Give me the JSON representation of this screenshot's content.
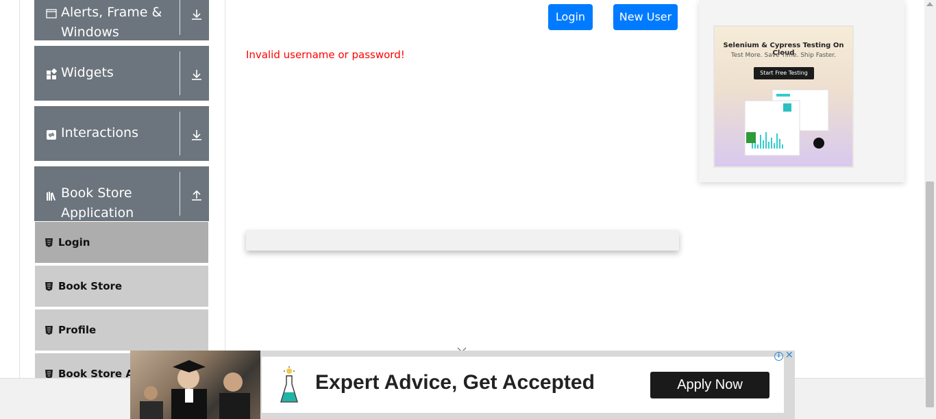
{
  "sidebar": {
    "groups": [
      {
        "label_line1": "Alerts, Frame &",
        "label_line2": "Windows",
        "icon": "window-icon",
        "arrow": "download-arrow-icon"
      },
      {
        "label": "Widgets",
        "icon": "widgets-icon",
        "arrow": "download-arrow-icon"
      },
      {
        "label": "Interactions",
        "icon": "interactions-icon",
        "arrow": "download-arrow-icon"
      },
      {
        "label_line1": "Book Store",
        "label_line2": "Application",
        "icon": "books-icon",
        "arrow": "upload-arrow-icon"
      }
    ],
    "items": [
      {
        "label": "Login",
        "active": true
      },
      {
        "label": "Book Store"
      },
      {
        "label": "Profile"
      },
      {
        "label": "Book Store API"
      }
    ]
  },
  "main": {
    "login_button": "Login",
    "new_user_button": "New User",
    "error_message": "Invalid username or password!"
  },
  "right_ad": {
    "title": "Selenium & Cypress Testing On Cloud",
    "subtitle": "Test More. Save Time. Ship Faster.",
    "cta": "Start Free Testing"
  },
  "bottom_ad": {
    "headline": "Expert Advice, Get Accepted",
    "cta": "Apply Now",
    "info": "i",
    "close": "✕"
  },
  "colors": {
    "sidebar_group": "#6c757d",
    "sidebar_item_active": "#adadad",
    "sidebar_item": "#cccccc",
    "primary_button": "#007bff",
    "error": "#ff0000"
  }
}
